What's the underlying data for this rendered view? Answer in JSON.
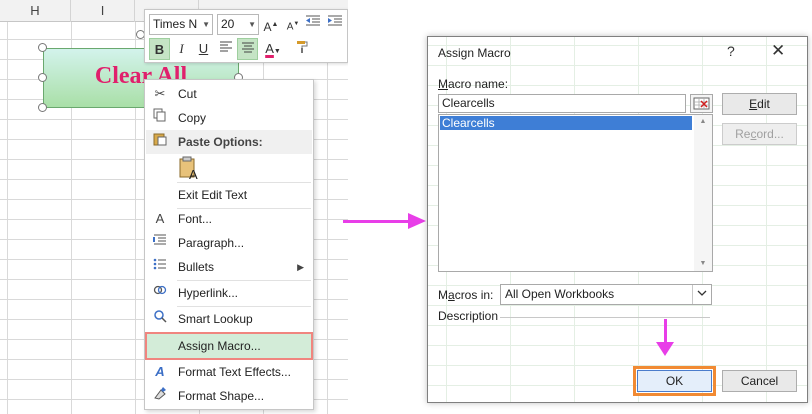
{
  "sheet": {
    "columns": [
      "H",
      "I"
    ],
    "shape_text": "Clear All"
  },
  "mini_toolbar": {
    "font_name": "Times N",
    "font_size": "20",
    "buttons": [
      "grow-font",
      "shrink-font",
      "outdent",
      "indent",
      "bold",
      "italic",
      "underline",
      "align-left",
      "align-center",
      "font-color",
      "format-painter"
    ],
    "font_color": "#e0206c"
  },
  "context_menu": {
    "items": [
      {
        "label": "Cut",
        "icon": "scissors-icon"
      },
      {
        "label": "Copy",
        "icon": "copy-icon"
      },
      {
        "label": "Paste Options:",
        "icon": "clipboard-icon"
      },
      {
        "label": "Exit Edit Text"
      },
      {
        "label": "Font...",
        "icon": "font-icon"
      },
      {
        "label": "Paragraph...",
        "icon": "paragraph-icon"
      },
      {
        "label": "Bullets",
        "icon": "bullets-icon"
      },
      {
        "label": "Hyperlink...",
        "icon": "link-icon"
      },
      {
        "label": "Smart Lookup",
        "icon": "search-icon"
      },
      {
        "label": "Assign Macro..."
      },
      {
        "label": "Format Text Effects...",
        "icon": "text-effects-icon"
      },
      {
        "label": "Format Shape...",
        "icon": "format-shape-icon"
      }
    ],
    "highlight_color": "#f0857f"
  },
  "dialog": {
    "title": "Assign Macro",
    "help": "?",
    "close": "✕",
    "macro_name_label": "Macro name:",
    "macro_name_value": "Clearcells",
    "list_items": [
      "Clearcells"
    ],
    "edit_label": "Edit",
    "record_label": "Record...",
    "macros_in_label": "Macros in:",
    "macros_in_value": "All Open Workbooks",
    "description_label": "Description",
    "ok_label": "OK",
    "cancel_label": "Cancel",
    "accent": "#f18a33"
  },
  "annotations": {
    "arrow_color": "#e83ee8"
  }
}
